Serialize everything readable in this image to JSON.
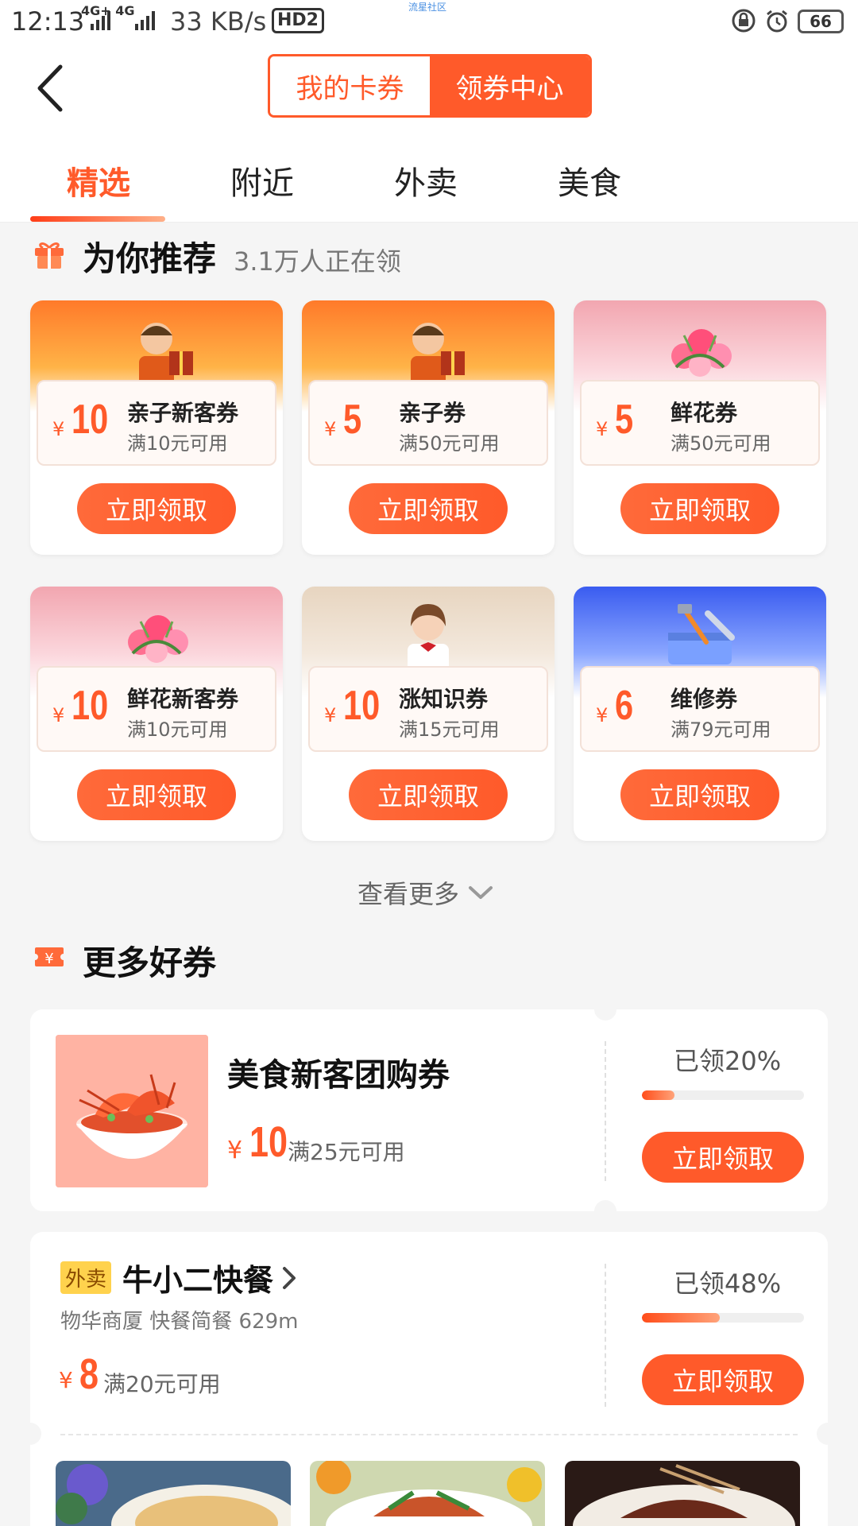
{
  "status_bar": {
    "time": "12:13",
    "network": "4G+ 4G",
    "speed": "33 KB/s",
    "hd": "HD2",
    "watermark": "流星社区",
    "battery": "66"
  },
  "header": {
    "segment_inactive": "我的卡券",
    "segment_active": "领券中心"
  },
  "tabs": [
    "精选",
    "附近",
    "外卖",
    "美食"
  ],
  "recommend": {
    "title": "为你推荐",
    "subtitle": "3.1万人正在领",
    "currency": "¥",
    "button_label": "立即领取",
    "cards": [
      {
        "amount": "10",
        "name": "亲子新客券",
        "condition": "满10元可用",
        "icon": "child-gift-icon",
        "banner": "orange"
      },
      {
        "amount": "5",
        "name": "亲子券",
        "condition": "满50元可用",
        "icon": "child-gift-icon",
        "banner": "orange"
      },
      {
        "amount": "5",
        "name": "鲜花券",
        "condition": "满50元可用",
        "icon": "flower-bouquet-icon",
        "banner": "pink"
      },
      {
        "amount": "10",
        "name": "鲜花新客券",
        "condition": "满10元可用",
        "icon": "flower-bouquet-icon",
        "banner": "pink"
      },
      {
        "amount": "10",
        "name": "涨知识券",
        "condition": "满15元可用",
        "icon": "student-icon",
        "banner": "beige"
      },
      {
        "amount": "6",
        "name": "维修券",
        "condition": "满79元可用",
        "icon": "toolbox-icon",
        "banner": "blue"
      }
    ],
    "see_more": "查看更多"
  },
  "more_coupons": {
    "title": "更多好券",
    "items": [
      {
        "name": "美食新客团购券",
        "currency": "¥",
        "amount": "10",
        "condition": "满25元可用",
        "claimed_label": "已领20%",
        "claimed_fraction": 0.2,
        "button": "立即领取"
      },
      {
        "tag": "外卖",
        "shop": "牛小二快餐",
        "info": "物华商厦 快餐简餐 629m",
        "currency": "¥",
        "amount": "8",
        "condition": "满20元可用",
        "claimed_label": "已领48%",
        "claimed_fraction": 0.48,
        "button": "立即领取"
      }
    ]
  },
  "colors": {
    "accent": "#ff5a2a",
    "background": "#f5f5f5",
    "tag_yellow": "#ffd24d"
  }
}
